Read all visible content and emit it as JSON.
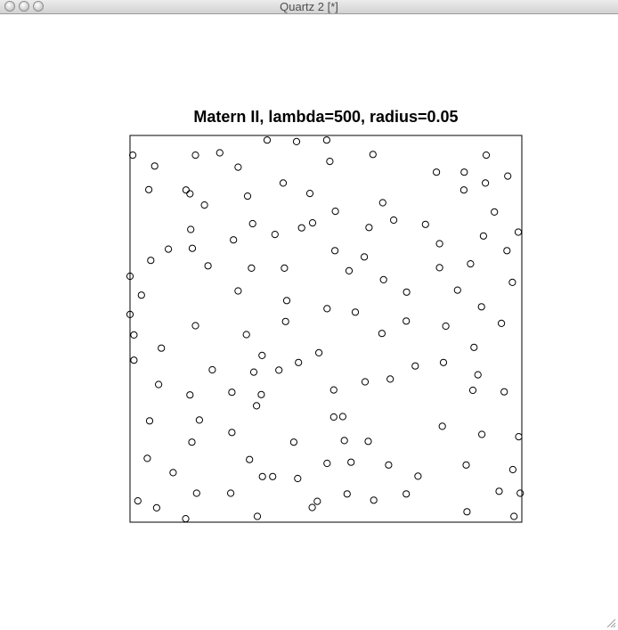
{
  "window": {
    "title": "Quartz 2 [*]",
    "buttons": [
      "close",
      "minimize",
      "zoom"
    ]
  },
  "chart_data": {
    "type": "scatter",
    "title": "Matern II, lambda=500, radius=0.05",
    "xlabel": "",
    "ylabel": "",
    "xlim": [
      0,
      1
    ],
    "ylim": [
      0,
      1
    ],
    "axes_visible": false,
    "frame": true,
    "grid": false,
    "marker": "open-circle",
    "marker_color": "#000000",
    "points": [
      [
        0.007,
        0.949
      ],
      [
        0.153,
        0.849
      ],
      [
        0.167,
        0.949
      ],
      [
        0.229,
        0.955
      ],
      [
        0.063,
        0.921
      ],
      [
        0.276,
        0.918
      ],
      [
        0.35,
        0.988
      ],
      [
        0.425,
        0.984
      ],
      [
        0.502,
        0.988
      ],
      [
        0.51,
        0.933
      ],
      [
        0.62,
        0.951
      ],
      [
        0.782,
        0.905
      ],
      [
        0.853,
        0.905
      ],
      [
        0.909,
        0.949
      ],
      [
        0.048,
        0.86
      ],
      [
        0.143,
        0.859
      ],
      [
        0.19,
        0.82
      ],
      [
        0.3,
        0.843
      ],
      [
        0.391,
        0.877
      ],
      [
        0.459,
        0.85
      ],
      [
        0.852,
        0.859
      ],
      [
        0.907,
        0.877
      ],
      [
        0.964,
        0.895
      ],
      [
        0.155,
        0.757
      ],
      [
        0.098,
        0.706
      ],
      [
        0.053,
        0.677
      ],
      [
        0.159,
        0.708
      ],
      [
        0.199,
        0.663
      ],
      [
        0.264,
        0.73
      ],
      [
        0.313,
        0.772
      ],
      [
        0.37,
        0.744
      ],
      [
        0.438,
        0.761
      ],
      [
        0.466,
        0.774
      ],
      [
        0.524,
        0.804
      ],
      [
        0.645,
        0.826
      ],
      [
        0.673,
        0.781
      ],
      [
        0.61,
        0.762
      ],
      [
        0.754,
        0.77
      ],
      [
        0.79,
        0.72
      ],
      [
        0.902,
        0.74
      ],
      [
        0.93,
        0.802
      ],
      [
        0.962,
        0.702
      ],
      [
        0.991,
        0.75
      ],
      [
        0.31,
        0.657
      ],
      [
        0.394,
        0.657
      ],
      [
        0.523,
        0.702
      ],
      [
        0.559,
        0.65
      ],
      [
        0.598,
        0.686
      ],
      [
        0.647,
        0.627
      ],
      [
        0.79,
        0.658
      ],
      [
        0.869,
        0.668
      ],
      [
        0.0,
        0.636
      ],
      [
        0.029,
        0.587
      ],
      [
        0.276,
        0.598
      ],
      [
        0.4,
        0.573
      ],
      [
        0.503,
        0.552
      ],
      [
        0.575,
        0.543
      ],
      [
        0.706,
        0.595
      ],
      [
        0.836,
        0.6
      ],
      [
        0.897,
        0.557
      ],
      [
        0.976,
        0.62
      ],
      [
        0.0,
        0.537
      ],
      [
        0.01,
        0.484
      ],
      [
        0.167,
        0.508
      ],
      [
        0.297,
        0.485
      ],
      [
        0.397,
        0.519
      ],
      [
        0.643,
        0.488
      ],
      [
        0.705,
        0.52
      ],
      [
        0.806,
        0.507
      ],
      [
        0.948,
        0.514
      ],
      [
        0.08,
        0.45
      ],
      [
        0.01,
        0.419
      ],
      [
        0.337,
        0.431
      ],
      [
        0.21,
        0.394
      ],
      [
        0.316,
        0.388
      ],
      [
        0.43,
        0.413
      ],
      [
        0.482,
        0.438
      ],
      [
        0.6,
        0.363
      ],
      [
        0.664,
        0.37
      ],
      [
        0.728,
        0.404
      ],
      [
        0.8,
        0.413
      ],
      [
        0.878,
        0.452
      ],
      [
        0.888,
        0.381
      ],
      [
        0.073,
        0.356
      ],
      [
        0.153,
        0.329
      ],
      [
        0.26,
        0.336
      ],
      [
        0.335,
        0.33
      ],
      [
        0.38,
        0.393
      ],
      [
        0.52,
        0.342
      ],
      [
        0.875,
        0.341
      ],
      [
        0.955,
        0.337
      ],
      [
        0.05,
        0.262
      ],
      [
        0.177,
        0.264
      ],
      [
        0.26,
        0.232
      ],
      [
        0.323,
        0.301
      ],
      [
        0.52,
        0.272
      ],
      [
        0.547,
        0.211
      ],
      [
        0.608,
        0.209
      ],
      [
        0.797,
        0.248
      ],
      [
        0.898,
        0.227
      ],
      [
        0.992,
        0.221
      ],
      [
        0.158,
        0.207
      ],
      [
        0.418,
        0.207
      ],
      [
        0.044,
        0.165
      ],
      [
        0.11,
        0.128
      ],
      [
        0.305,
        0.162
      ],
      [
        0.338,
        0.118
      ],
      [
        0.428,
        0.113
      ],
      [
        0.503,
        0.152
      ],
      [
        0.564,
        0.155
      ],
      [
        0.66,
        0.148
      ],
      [
        0.735,
        0.119
      ],
      [
        0.858,
        0.148
      ],
      [
        0.977,
        0.136
      ],
      [
        0.17,
        0.075
      ],
      [
        0.257,
        0.075
      ],
      [
        0.478,
        0.054
      ],
      [
        0.02,
        0.055
      ],
      [
        0.068,
        0.037
      ],
      [
        0.142,
        0.009
      ],
      [
        0.325,
        0.015
      ],
      [
        0.465,
        0.038
      ],
      [
        0.554,
        0.073
      ],
      [
        0.622,
        0.057
      ],
      [
        0.705,
        0.073
      ],
      [
        0.86,
        0.027
      ],
      [
        0.942,
        0.08
      ],
      [
        0.98,
        0.015
      ],
      [
        0.996,
        0.075
      ],
      [
        0.543,
        0.273
      ],
      [
        0.364,
        0.118
      ]
    ]
  }
}
